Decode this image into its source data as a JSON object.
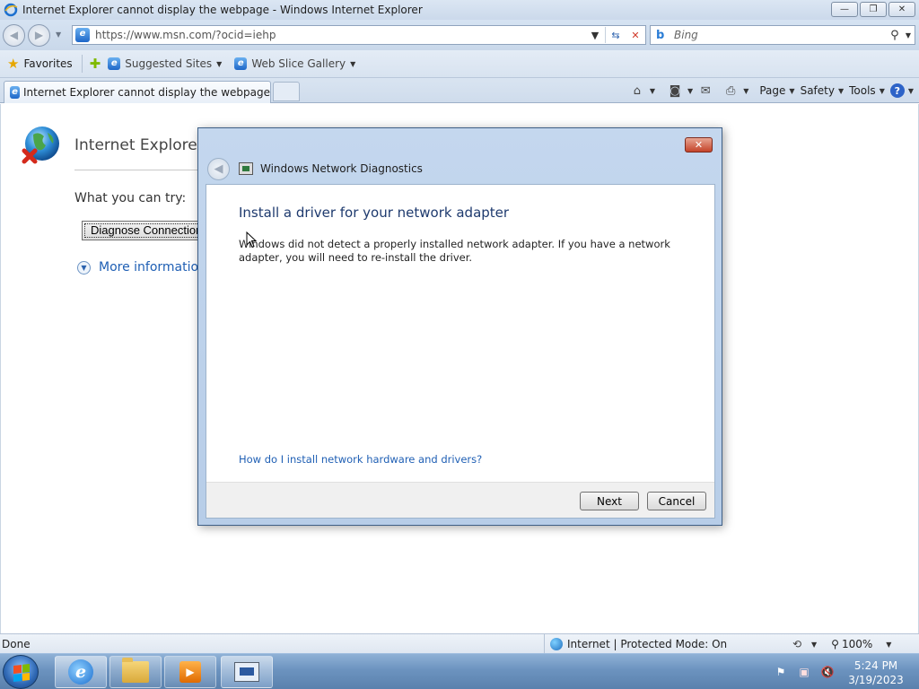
{
  "window": {
    "title": "Internet Explorer cannot display the webpage - Windows Internet Explorer",
    "min_label": "—",
    "restore_label": "❐",
    "close_label": "✕"
  },
  "nav": {
    "back_icon": "back-arrow-icon",
    "forward_icon": "forward-arrow-icon",
    "url": "https://www.msn.com/?ocid=iehp",
    "search_placeholder": "Bing",
    "search_brand": "b"
  },
  "favorites": {
    "favorites_label": "Favorites",
    "items": [
      {
        "label": "Suggested Sites"
      },
      {
        "label": "Web Slice Gallery"
      }
    ]
  },
  "tab": {
    "title": "Internet Explorer cannot display the webpage"
  },
  "command_bar": {
    "page_label": "Page",
    "safety_label": "Safety",
    "tools_label": "Tools",
    "help_label": "?"
  },
  "page": {
    "title": "Internet Explorer c",
    "try_label": "What you can try:",
    "diagnose_label": "Diagnose Connection Problems",
    "more_info_label": "More information"
  },
  "dialog": {
    "close_label": "✕",
    "title": "Windows Network Diagnostics",
    "heading": "Install a driver for your network adapter",
    "message": "Windows did not detect a properly installed network adapter. If you have a network adapter, you will need to re-install the driver.",
    "help_link": "How do I install network hardware and drivers?",
    "next_label": "Next",
    "cancel_label": "Cancel"
  },
  "status": {
    "text": "Done",
    "zone": "Internet | Protected Mode: On",
    "zoom": "100%"
  },
  "taskbar": {
    "time": "5:24 PM",
    "date": "3/19/2023"
  },
  "colors": {
    "link": "#1f5fb4",
    "dialog_heading": "#1e3a6e",
    "taskbar": "#6c93bf"
  }
}
